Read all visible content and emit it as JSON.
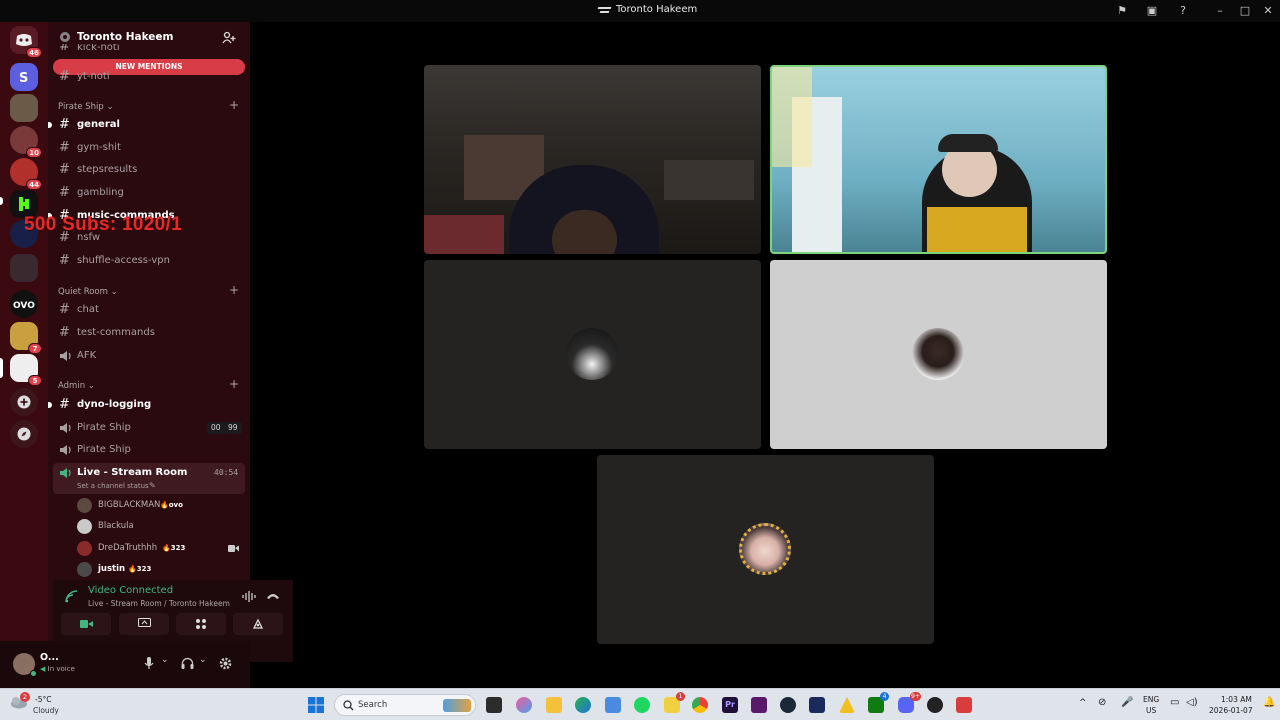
{
  "window": {
    "title": "Toronto Hakeem"
  },
  "rail": {
    "badges": [
      "46",
      "10",
      "44",
      "7",
      "5"
    ]
  },
  "sidebar": {
    "server_name": "Toronto Hakeem",
    "hidden_channels": [
      "kick-noti",
      "yt-noti"
    ],
    "new_mentions": "NEW MENTIONS",
    "categories": [
      {
        "name": "Pirate Ship",
        "channels": [
          "general",
          "gym-shit",
          "stepsresults",
          "gambling",
          "music-commands",
          "nsfw",
          "shuffle-access-vpn"
        ]
      },
      {
        "name": "Quiet Room",
        "channels": [
          "chat",
          "test-commands",
          "AFK"
        ]
      },
      {
        "name": "Admin",
        "channels": [
          "dyno-logging",
          "Pirate Ship",
          "Pirate Ship",
          "Live - Stream Room"
        ]
      }
    ],
    "pirate_ship_counts": [
      "00",
      "99"
    ],
    "live_room": {
      "name": "Live - Stream Room",
      "timer": "40:54",
      "status": "Set a channel status",
      "members": [
        {
          "name": "BIGBLACKMAN",
          "tag": "ovo"
        },
        {
          "name": "Blackula",
          "tag": ""
        },
        {
          "name": "DreDaTruthhh",
          "tag": "323"
        },
        {
          "name": "justin",
          "tag": "323"
        }
      ]
    }
  },
  "overlay": {
    "subs_text": "500 Subs: 1020/1"
  },
  "voice_panel": {
    "status": "Video Connected",
    "location": "Live - Stream Room / Toronto Hakeem"
  },
  "user_panel": {
    "name": "O...",
    "status": "In voice"
  },
  "taskbar": {
    "weather_temp": "-5°C",
    "weather_desc": "Cloudy",
    "weather_badge": "2",
    "search_placeholder": "Search",
    "lang_top": "ENG",
    "lang_bottom": "US",
    "time": "1:03 AM",
    "date": "2026-01-07",
    "tray_badges": [
      "1",
      "4",
      "9+"
    ]
  },
  "colors": {
    "rail": "#3a0a10",
    "sidebar": "#2a0a0f",
    "mentions": "#d83c46",
    "connected": "#43b581",
    "speaking_border": "#7bd67b"
  }
}
